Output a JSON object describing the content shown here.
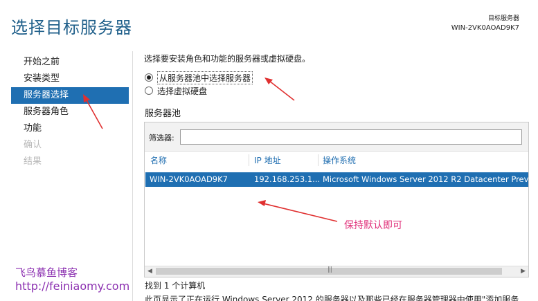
{
  "header": {
    "title": "选择目标服务器",
    "dest_label": "目标服务器",
    "dest_value": "WIN-2VK0AOAD9K7"
  },
  "nav": {
    "items": [
      {
        "label": "开始之前",
        "state": "normal"
      },
      {
        "label": "安装类型",
        "state": "normal"
      },
      {
        "label": "服务器选择",
        "state": "selected"
      },
      {
        "label": "服务器角色",
        "state": "normal"
      },
      {
        "label": "功能",
        "state": "normal"
      },
      {
        "label": "确认",
        "state": "disabled"
      },
      {
        "label": "结果",
        "state": "disabled"
      }
    ]
  },
  "main": {
    "intro": "选择要安装角色和功能的服务器或虚拟硬盘。",
    "options": [
      {
        "label": "从服务器池中选择服务器",
        "checked": true
      },
      {
        "label": "选择虚拟硬盘",
        "checked": false
      }
    ],
    "pool_heading": "服务器池",
    "filter_label": "筛选器:",
    "filter_value": "",
    "columns": [
      "名称",
      "IP 地址",
      "操作系统"
    ],
    "rows": [
      {
        "name": "WIN-2VK0AOAD9K7",
        "ip": "192.168.253.1...",
        "os": "Microsoft Windows Server 2012 R2 Datacenter Prev"
      }
    ],
    "found_text": "找到 1 个计算机",
    "description": "此页显示了正在运行 Windows Server 2012 的服务器以及那些已经在服务器管理器中使用\"添加服务"
  },
  "overlay": {
    "annotation": "保持默认即可",
    "watermark_name": "飞鸟慕鱼博客",
    "watermark_url": "http://feiniaomy.com",
    "accent_color": "#1f6fb2",
    "arrow_color": "#e03030",
    "annotation_color": "#e0307a",
    "watermark_color": "#8b2fb0"
  }
}
